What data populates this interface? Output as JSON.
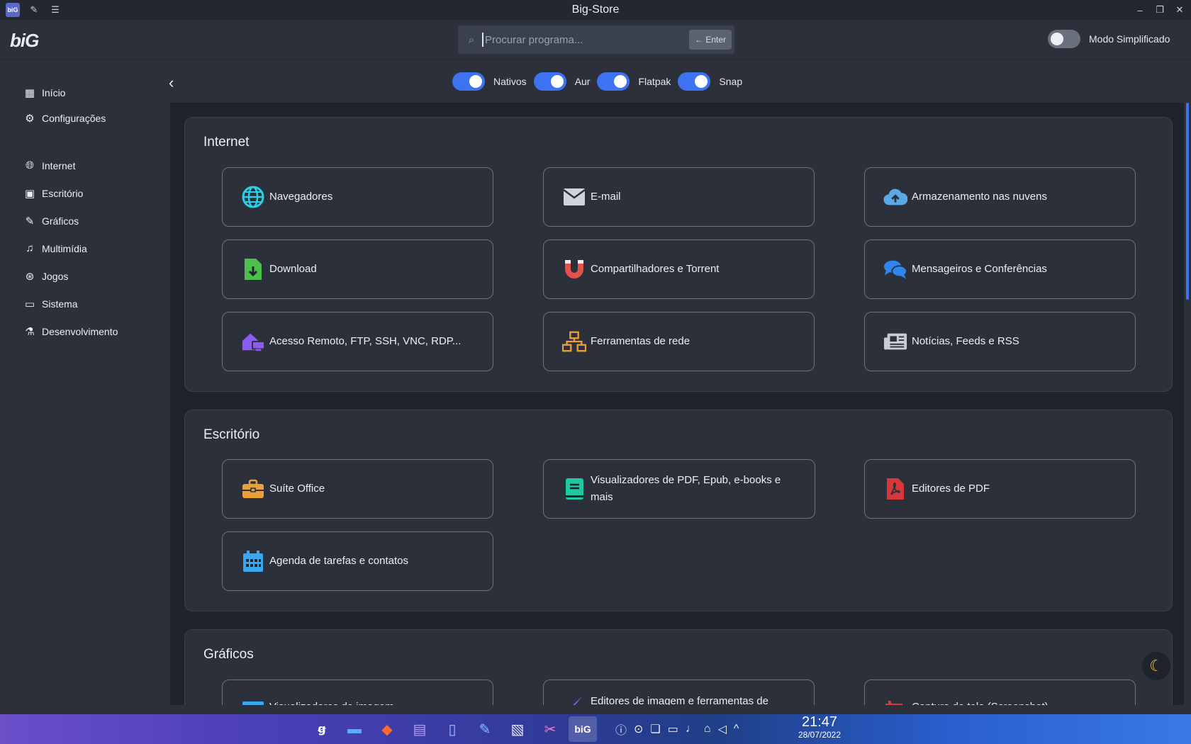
{
  "window": {
    "title": "Big-Store"
  },
  "header": {
    "logo": "biG",
    "search_placeholder": "Procurar programa...",
    "enter_label": "← Enter",
    "simplified_label": "Modo Simplificado"
  },
  "sidebar": {
    "top": [
      {
        "label": "Início",
        "icon": "grid-icon"
      },
      {
        "label": "Configurações",
        "icon": "gear-icon"
      }
    ],
    "categories": [
      {
        "label": "Internet",
        "icon": "globe-icon"
      },
      {
        "label": "Escritório",
        "icon": "briefcase-icon"
      },
      {
        "label": "Gráficos",
        "icon": "brush-icon"
      },
      {
        "label": "Multimídia",
        "icon": "music-icon"
      },
      {
        "label": "Jogos",
        "icon": "gamepad-icon"
      },
      {
        "label": "Sistema",
        "icon": "monitor-icon"
      },
      {
        "label": "Desenvolvimento",
        "icon": "flask-icon"
      }
    ]
  },
  "filters": [
    {
      "label": "Nativos",
      "on": true
    },
    {
      "label": "Aur",
      "on": true
    },
    {
      "label": "Flatpak",
      "on": true
    },
    {
      "label": "Snap",
      "on": true
    }
  ],
  "sections": [
    {
      "title": "Internet",
      "cards": [
        {
          "label": "Navegadores",
          "icon": "globe-icon",
          "color": "#2ad1e6"
        },
        {
          "label": "E-mail",
          "icon": "envelope-icon",
          "color": "#cfd3da"
        },
        {
          "label": "Armazenamento nas nuvens",
          "icon": "cloud-upload-icon",
          "color": "#5aa9e6"
        },
        {
          "label": "Download",
          "icon": "file-download-icon",
          "color": "#4cc04a"
        },
        {
          "label": "Compartilhadores e Torrent",
          "icon": "magnet-icon",
          "color": "#e4504a"
        },
        {
          "label": "Mensageiros e Conferências",
          "icon": "chat-icon",
          "color": "#2f86f0"
        },
        {
          "label": "Acesso Remoto, FTP, SSH, VNC, RDP...",
          "icon": "remote-house-icon",
          "color": "#8a5cf0"
        },
        {
          "label": "Ferramentas de rede",
          "icon": "network-icon",
          "color": "#e8a03a"
        },
        {
          "label": "Notícias, Feeds e RSS",
          "icon": "newspaper-icon",
          "color": "#c9ccd3"
        }
      ]
    },
    {
      "title": "Escritório",
      "cards": [
        {
          "label": "Suíte Office",
          "icon": "briefcase-icon",
          "color": "#e8a03a"
        },
        {
          "label": "Visualizadores de PDF, Epub, e-books e mais",
          "icon": "book-icon",
          "color": "#1fc9a0"
        },
        {
          "label": "Editores de PDF",
          "icon": "pdf-icon",
          "color": "#d8383a"
        },
        {
          "label": "Agenda de tarefas e contatos",
          "icon": "calendar-icon",
          "color": "#3aa8f0"
        }
      ]
    },
    {
      "title": "Gráficos",
      "cards": [
        {
          "label": "Visualizadores de imagem",
          "icon": "image-icon",
          "color": "#3aa8f0"
        },
        {
          "label": "Editores de imagem e ferramentas de",
          "icon": "brush-icon",
          "color": "#8a5cf0"
        },
        {
          "label": "Captura de tela (Screenshot)",
          "icon": "crop-icon",
          "color": "#d8383a"
        }
      ]
    }
  ],
  "taskbar": {
    "time": "21:47",
    "date": "28/07/2022"
  },
  "colors": {
    "accent": "#3d72f0",
    "background": "#2b303b",
    "panel": "#1f232b"
  }
}
